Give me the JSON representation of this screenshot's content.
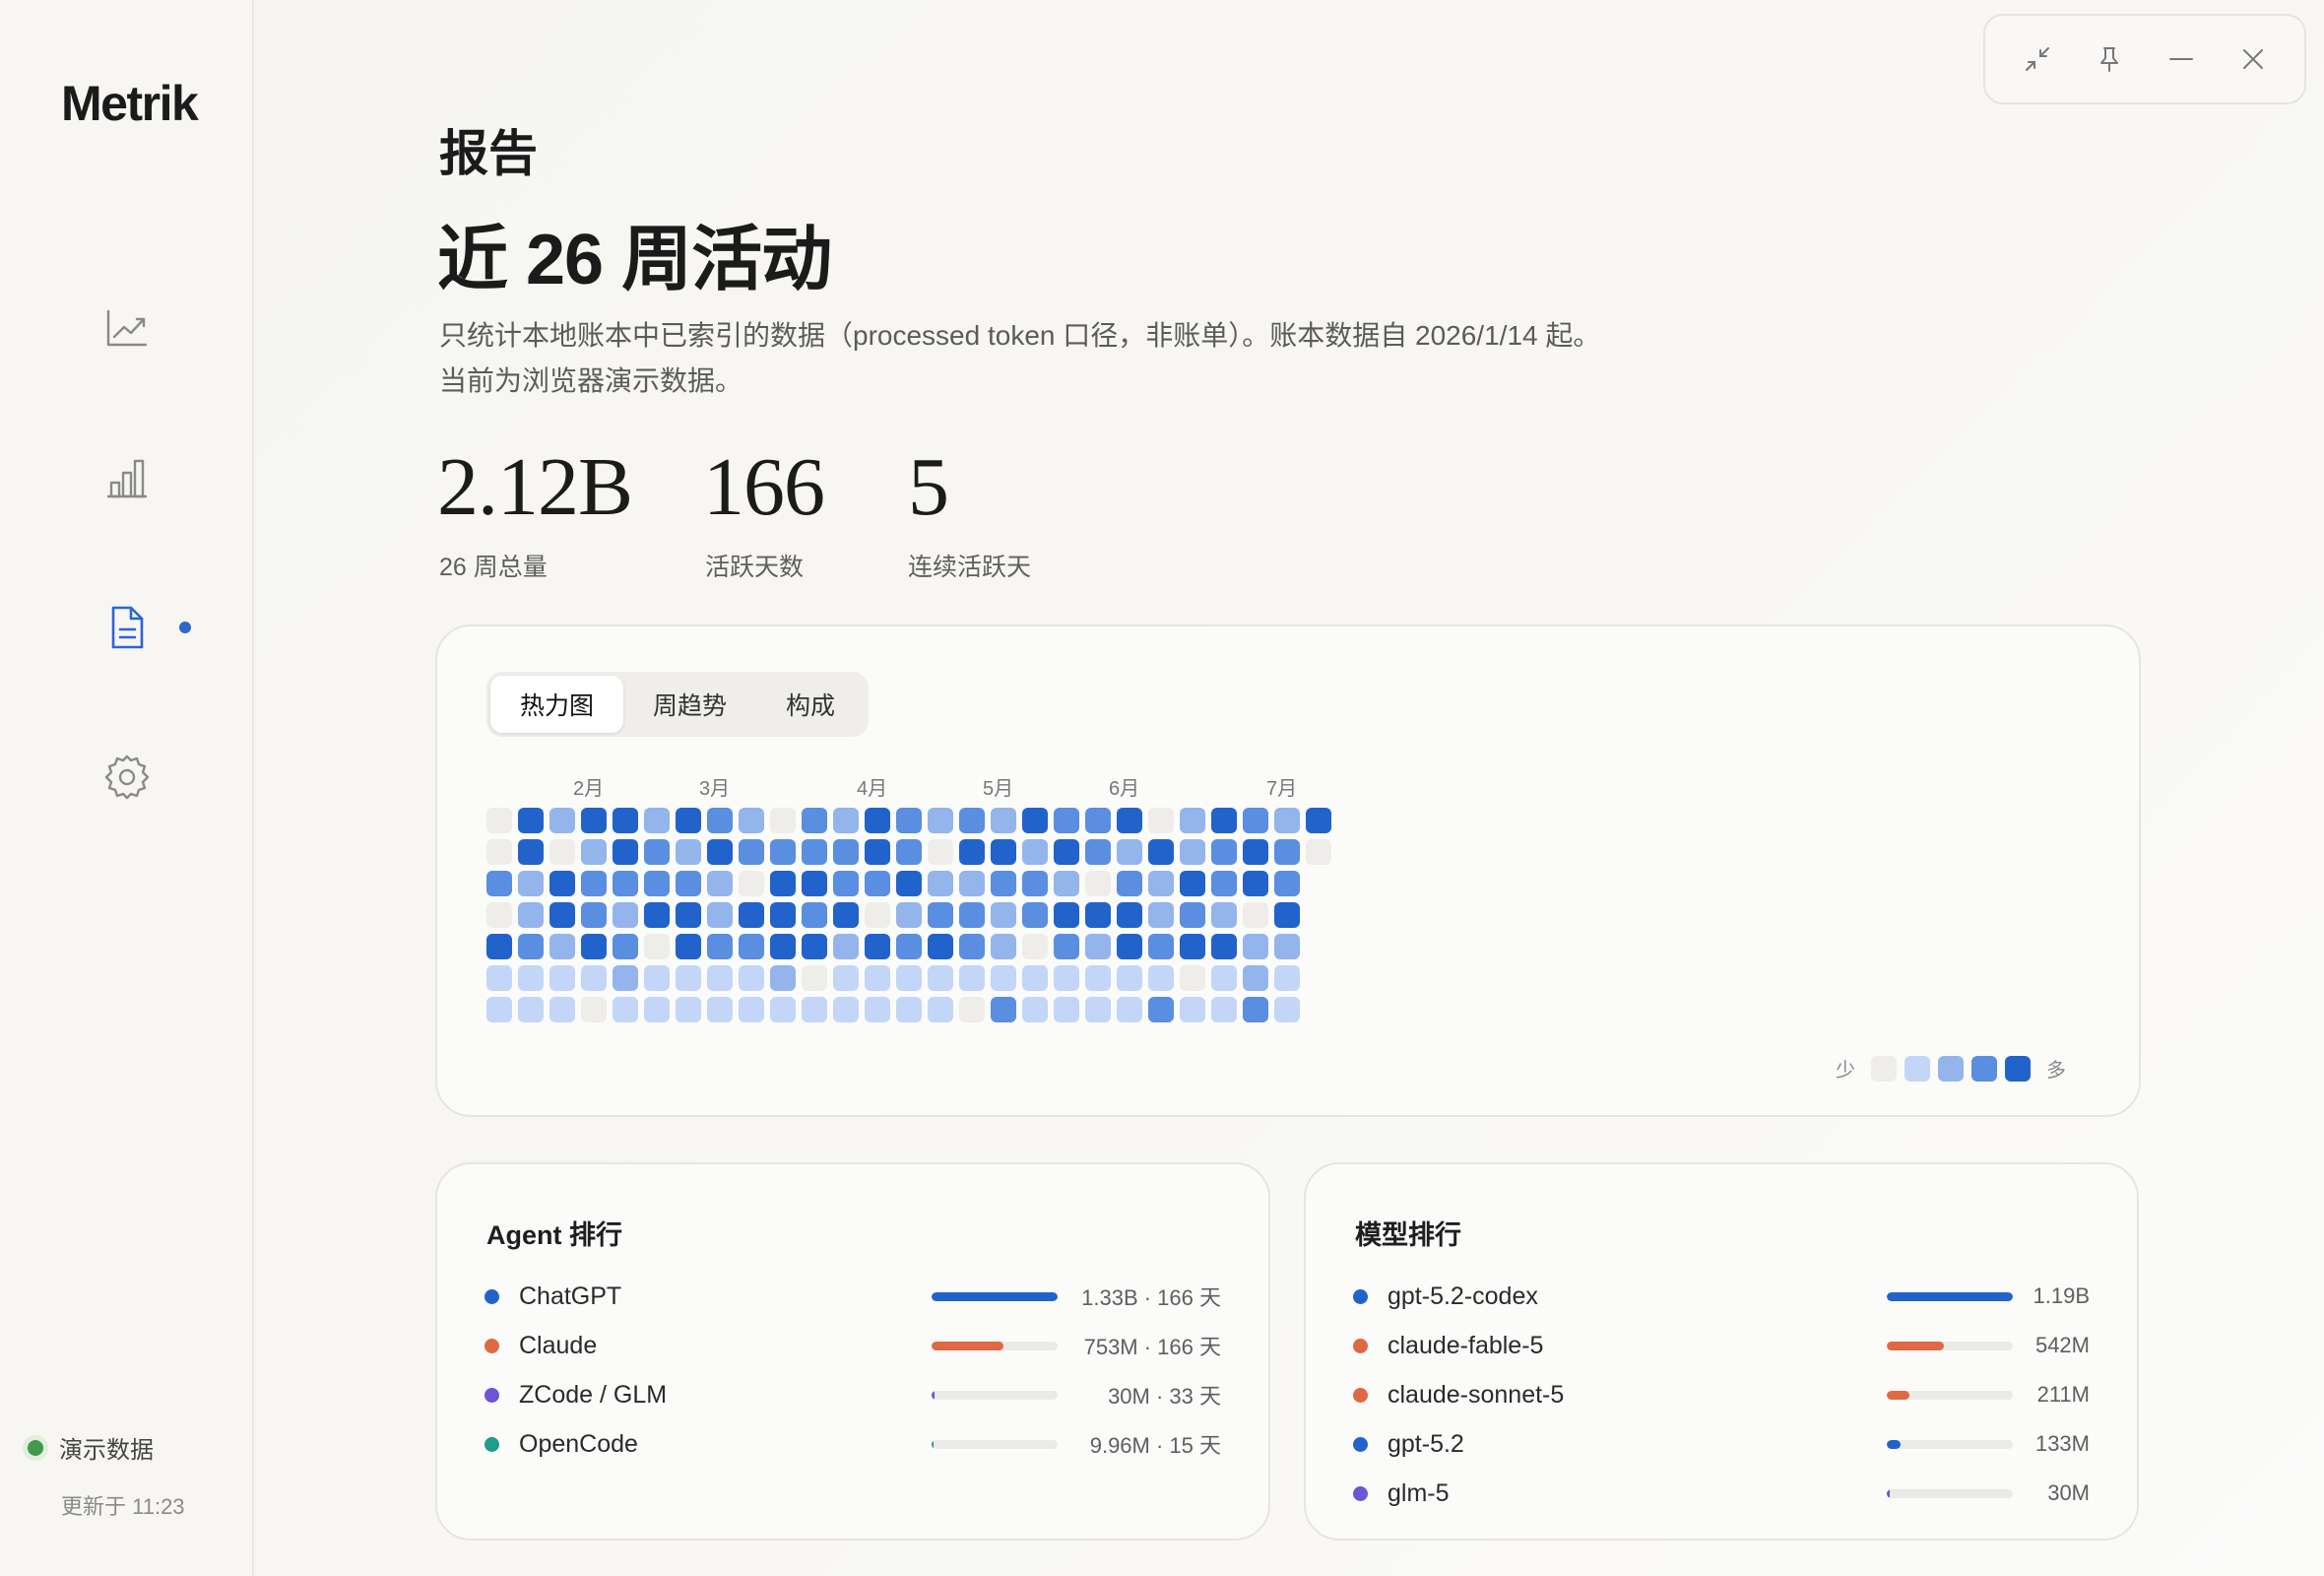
{
  "brand": "Metrik",
  "sidebar": {
    "items": [
      {
        "name": "trend",
        "icon": "line-chart-icon",
        "active": false
      },
      {
        "name": "bars",
        "icon": "bar-chart-icon",
        "active": false
      },
      {
        "name": "reports",
        "icon": "document-icon",
        "active": true
      },
      {
        "name": "settings",
        "icon": "gear-icon",
        "active": false
      }
    ],
    "status_label": "演示数据",
    "updated": "更新于 11:23"
  },
  "window_controls": [
    "collapse-icon",
    "pin-icon",
    "minimize-icon",
    "close-icon"
  ],
  "header": {
    "eyebrow": "报告",
    "title": "近 26 周活动",
    "desc_line1": "只统计本地账本中已索引的数据（processed token 口径，非账单）。账本数据自 2026/1/14 起。",
    "desc_line2": "当前为浏览器演示数据。"
  },
  "stats": [
    {
      "value": "2.12B",
      "label": "26 周总量"
    },
    {
      "value": "166",
      "label": "活跃天数"
    },
    {
      "value": "5",
      "label": "连续活跃天"
    }
  ],
  "tabs": [
    {
      "label": "热力图",
      "active": true
    },
    {
      "label": "周趋势",
      "active": false
    },
    {
      "label": "构成",
      "active": false
    }
  ],
  "heatmap": {
    "months": [
      {
        "label": "2月",
        "col": 3
      },
      {
        "label": "3月",
        "col": 7
      },
      {
        "label": "4月",
        "col": 12
      },
      {
        "label": "5月",
        "col": 16
      },
      {
        "label": "6月",
        "col": 20
      },
      {
        "label": "7月",
        "col": 25
      }
    ],
    "levels": [
      "#eeedea",
      "#c3d6f7",
      "#93b5ec",
      "#5a8ee0",
      "#2163cb"
    ],
    "weeks": [
      [
        0,
        0,
        3,
        0,
        4,
        1,
        1
      ],
      [
        4,
        4,
        2,
        2,
        3,
        1,
        1
      ],
      [
        2,
        0,
        4,
        4,
        2,
        1,
        1
      ],
      [
        4,
        2,
        3,
        3,
        4,
        1,
        0
      ],
      [
        4,
        4,
        3,
        2,
        3,
        2,
        1
      ],
      [
        2,
        3,
        3,
        4,
        0,
        1,
        1
      ],
      [
        4,
        2,
        3,
        4,
        4,
        1,
        1
      ],
      [
        3,
        4,
        2,
        2,
        3,
        1,
        1
      ],
      [
        2,
        3,
        0,
        4,
        3,
        1,
        1
      ],
      [
        0,
        3,
        4,
        4,
        4,
        2,
        1
      ],
      [
        3,
        3,
        4,
        3,
        4,
        0,
        1
      ],
      [
        2,
        3,
        3,
        4,
        2,
        1,
        1
      ],
      [
        4,
        4,
        3,
        0,
        4,
        1,
        1
      ],
      [
        3,
        3,
        4,
        2,
        3,
        1,
        1
      ],
      [
        2,
        0,
        2,
        3,
        4,
        1,
        1
      ],
      [
        3,
        4,
        2,
        3,
        3,
        1,
        0
      ],
      [
        2,
        4,
        3,
        2,
        2,
        1,
        3
      ],
      [
        4,
        2,
        3,
        3,
        0,
        1,
        1
      ],
      [
        3,
        4,
        2,
        4,
        3,
        1,
        1
      ],
      [
        3,
        3,
        0,
        4,
        2,
        1,
        1
      ],
      [
        4,
        2,
        3,
        4,
        4,
        1,
        1
      ],
      [
        0,
        4,
        2,
        2,
        3,
        1,
        3
      ],
      [
        2,
        2,
        4,
        3,
        4,
        0,
        1
      ],
      [
        4,
        3,
        3,
        2,
        4,
        1,
        1
      ],
      [
        3,
        4,
        4,
        0,
        2,
        2,
        3
      ],
      [
        2,
        3,
        3,
        4,
        2,
        1,
        1
      ],
      [
        4,
        0,
        -1,
        -1,
        -1,
        -1,
        -1
      ]
    ],
    "legend_low": "少",
    "legend_high": "多"
  },
  "agent_ranking": {
    "title": "Agent 排行",
    "rows": [
      {
        "name": "ChatGPT",
        "color": "#2163cb",
        "fraction": 1.0,
        "value": "1.33B · 166 天"
      },
      {
        "name": "Claude",
        "color": "#e06843",
        "fraction": 0.57,
        "value": "753M · 166 天"
      },
      {
        "name": "ZCode / GLM",
        "color": "#6e54d6",
        "fraction": 0.023,
        "value": "30M · 33 天"
      },
      {
        "name": "OpenCode",
        "color": "#1f9c8a",
        "fraction": 0.008,
        "value": "9.96M · 15 天"
      }
    ]
  },
  "model_ranking": {
    "title": "模型排行",
    "rows": [
      {
        "name": "gpt-5.2-codex",
        "color": "#2163cb",
        "fraction": 1.0,
        "value": "1.19B"
      },
      {
        "name": "claude-fable-5",
        "color": "#e06843",
        "fraction": 0.455,
        "value": "542M"
      },
      {
        "name": "claude-sonnet-5",
        "color": "#e06843",
        "fraction": 0.177,
        "value": "211M"
      },
      {
        "name": "gpt-5.2",
        "color": "#2163cb",
        "fraction": 0.112,
        "value": "133M"
      },
      {
        "name": "glm-5",
        "color": "#6e54d6",
        "fraction": 0.025,
        "value": "30M"
      }
    ]
  }
}
